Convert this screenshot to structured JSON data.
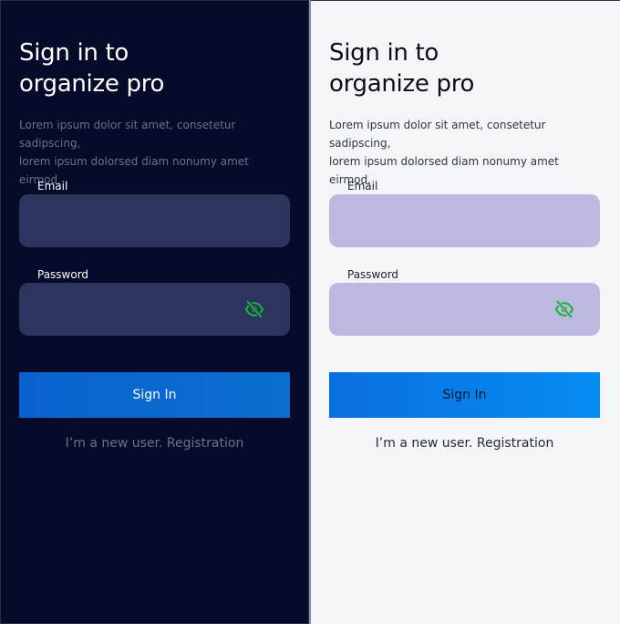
{
  "colors": {
    "dark_background": "#050b28",
    "dark_field": "#2d355e",
    "light_background": "#f4f5f7",
    "light_field": "#bbb9e0",
    "button_blue": "#0a6fde",
    "eye_icon_green": "#17b33a"
  },
  "dark": {
    "title_line1": "Sign in to",
    "title_line2": "organize pro",
    "description_line1": "Lorem ipsum dolor sit amet, consetetur sadipscing,",
    "description_line2": "lorem ipsum dolorsed diam nonumy amet eirmod.",
    "email_label": "Email",
    "email_value": "",
    "password_label": "Password",
    "password_value": "",
    "password_toggle_icon": "eye-off-icon",
    "signin_label": "Sign In",
    "register_link": "I’m a new user. Registration"
  },
  "light": {
    "title_line1": "Sign in to",
    "title_line2": "organize pro",
    "description_line1": "Lorem ipsum dolor sit amet, consetetur sadipscing,",
    "description_line2": "lorem ipsum dolorsed diam nonumy amet eirmod.",
    "email_label": "Email",
    "email_value": "",
    "password_label": "Password",
    "password_value": "",
    "password_toggle_icon": "eye-off-icon",
    "signin_label": "Sign In",
    "register_link": "I’m a new user. Registration"
  }
}
